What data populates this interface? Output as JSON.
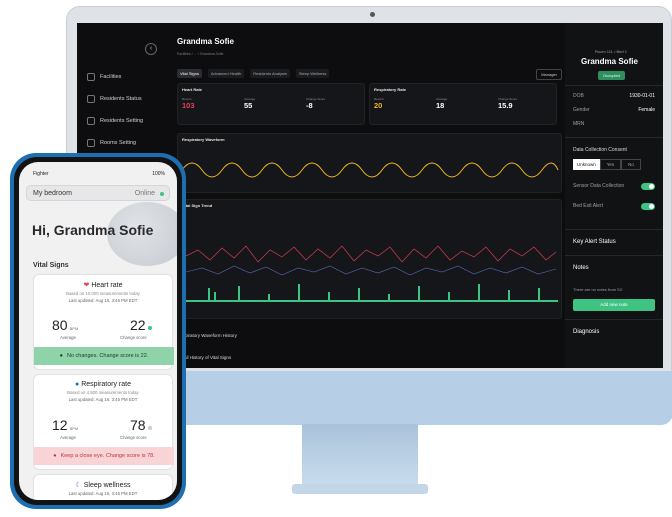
{
  "desktop": {
    "sidebar": [
      "Facilities",
      "Residents Status",
      "Residents Setting",
      "Rooms Setting"
    ],
    "collapse": "‹",
    "patient_name": "Grandma Sofie",
    "breadcrumb": "Facilities / … / Grandma Sofie",
    "tabs": [
      "Vital Signs",
      "Advanced Health",
      "Residents Analysis",
      "Sleep Wellness"
    ],
    "manager_btn": "Manager",
    "heart": {
      "title": "Heart Rate",
      "current": "103",
      "average": "55",
      "change": "-8"
    },
    "resp": {
      "title": "Respiratory Rate",
      "current": "20",
      "average": "18",
      "change": "15.9"
    },
    "labels": {
      "current": "Recent",
      "average": "Average",
      "change": "Change Score"
    },
    "waveform_title": "Respiratory Waveform",
    "trend_title": "Vital Sign Trend",
    "history1": "Respiratory Waveform History",
    "history2": "Detail History of Vital Signs",
    "right_panel": {
      "room": "Room 111 • Bed 1",
      "name": "Grandma Sofie",
      "badge": "Occupied",
      "dob_label": "DOB",
      "dob": "1930-01-01",
      "gender_label": "Gender",
      "gender": "Female",
      "mrn_label": "MRN",
      "consent_title": "Data Collection Consent",
      "consent_opts": [
        "Unknown",
        "Yes",
        "No"
      ],
      "sensor": "Sensor Data Collection",
      "bed_exit": "Bed Exit Alert",
      "key_alert": "Key Alert Status",
      "notes": "Notes",
      "notes_empty": "There are no notes from SX",
      "add_note": "Add new note",
      "diagnosis": "Diagnosis"
    }
  },
  "phone": {
    "carrier": "Fighter",
    "battery": "100%",
    "room": "My bedroom",
    "online": "Online",
    "greeting": "Hi, Grandma Sofie",
    "section": "Vital Signs",
    "heart": {
      "title": "Heart rate",
      "based": "Based on 10,000 measurements today",
      "updated": "Last updated: Aug 16, 3:45 PM EDT",
      "avg": "80",
      "unit": "BPM",
      "avg_label": "Average",
      "change": "22",
      "change_label": "Change score",
      "banner": "No changes. Change score is 22."
    },
    "resp": {
      "title": "Respiratory rate",
      "based": "Based on 4,500 measurements today",
      "updated": "Last updated: Aug 16, 3:45 PM EDT",
      "avg": "12",
      "unit": "BPM",
      "avg_label": "Average",
      "change": "78",
      "change_label": "Change score",
      "banner": "Keep a close eye. Change score is 78."
    },
    "sleep": {
      "title": "Sleep wellness",
      "updated": "Last updated: Aug 16, 3:45 PM EDT"
    }
  },
  "colors": {
    "alert_red": "#e9405a",
    "amber": "#f0b429",
    "green": "#3fc383",
    "phone_frame": "#1d6fb2"
  }
}
